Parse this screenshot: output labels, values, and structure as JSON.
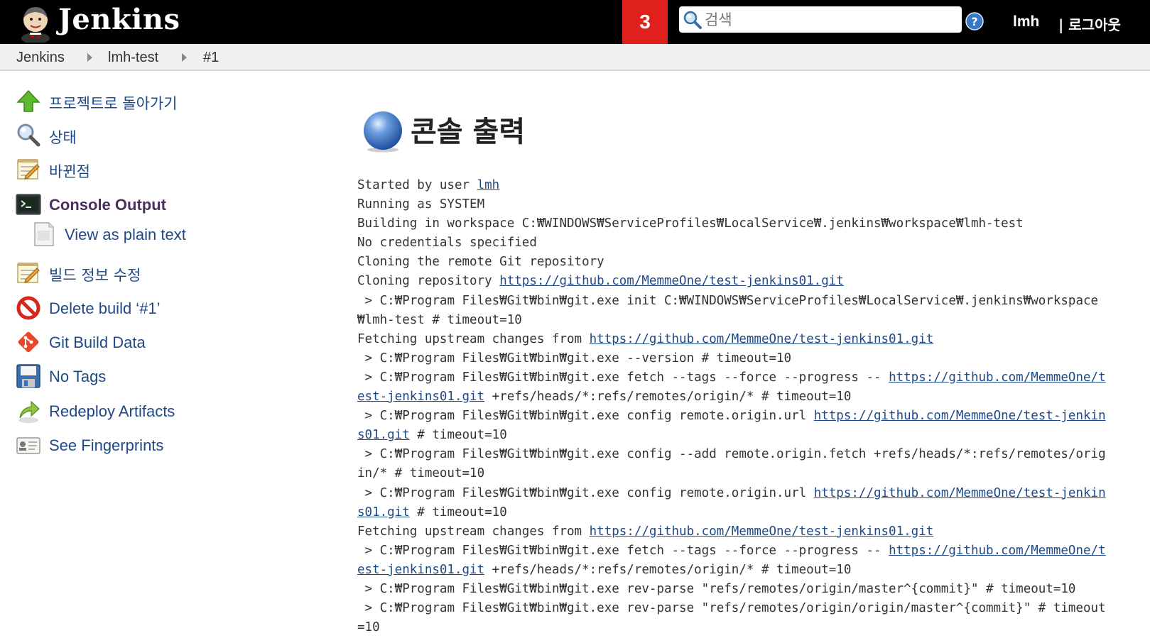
{
  "header": {
    "brand": "Jenkins",
    "notification_count": "3",
    "search_placeholder": "검색",
    "user": "lmh",
    "logout": "| 로그아웃"
  },
  "breadcrumb": [
    "Jenkins",
    "lmh-test",
    "#1"
  ],
  "side_panel": [
    {
      "label": "프로젝트로 돌아가기",
      "icon": "up-arrow-icon"
    },
    {
      "label": "상태",
      "icon": "magnifier-icon"
    },
    {
      "label": "바뀐점",
      "icon": "notepad-icon"
    },
    {
      "label": "Console Output",
      "icon": "terminal-icon",
      "active": true
    },
    {
      "label": "View as plain text",
      "icon": "document-icon"
    },
    {
      "label": "빌드 정보 수정",
      "icon": "notepad-icon"
    },
    {
      "label": "Delete build ‘#1’",
      "icon": "no-entry-icon"
    },
    {
      "label": "Git Build Data",
      "icon": "git-icon"
    },
    {
      "label": "No Tags",
      "icon": "floppy-disk-icon"
    },
    {
      "label": "Redeploy Artifacts",
      "icon": "redeploy-arrow-icon"
    },
    {
      "label": "See Fingerprints",
      "icon": "fingerprint-card-icon"
    }
  ],
  "main": {
    "title": "콘솔 출력",
    "console_lines": [
      [
        {
          "t": "Started by user "
        },
        {
          "t": "lmh",
          "link": true
        }
      ],
      [
        {
          "t": "Running as SYSTEM"
        }
      ],
      [
        {
          "t": "Building in workspace C:₩WINDOWS₩ServiceProfiles₩LocalService₩.jenkins₩workspace₩lmh-test"
        }
      ],
      [
        {
          "t": "No credentials specified"
        }
      ],
      [
        {
          "t": "Cloning the remote Git repository"
        }
      ],
      [
        {
          "t": "Cloning repository "
        },
        {
          "t": "https://github.com/MemmeOne/test-jenkins01.git",
          "link": true
        }
      ],
      [
        {
          "t": " > C:₩Program Files₩Git₩bin₩git.exe init C:₩WINDOWS₩ServiceProfiles₩LocalService₩.jenkins₩workspace₩lmh-test # timeout=10"
        }
      ],
      [
        {
          "t": "Fetching upstream changes from "
        },
        {
          "t": "https://github.com/MemmeOne/test-jenkins01.git",
          "link": true
        }
      ],
      [
        {
          "t": " > C:₩Program Files₩Git₩bin₩git.exe --version # timeout=10"
        }
      ],
      [
        {
          "t": " > C:₩Program Files₩Git₩bin₩git.exe fetch --tags --force --progress -- "
        },
        {
          "t": "https://github.com/MemmeOne/test-jenkins01.git",
          "link": true
        },
        {
          "t": " +refs/heads/*:refs/remotes/origin/* # timeout=10"
        }
      ],
      [
        {
          "t": " > C:₩Program Files₩Git₩bin₩git.exe config remote.origin.url "
        },
        {
          "t": "https://github.com/MemmeOne/test-jenkins01.git",
          "link": true
        },
        {
          "t": " # timeout=10"
        }
      ],
      [
        {
          "t": " > C:₩Program Files₩Git₩bin₩git.exe config --add remote.origin.fetch +refs/heads/*:refs/remotes/origin/* # timeout=10"
        }
      ],
      [
        {
          "t": " > C:₩Program Files₩Git₩bin₩git.exe config remote.origin.url "
        },
        {
          "t": "https://github.com/MemmeOne/test-jenkins01.git",
          "link": true
        },
        {
          "t": " # timeout=10"
        }
      ],
      [
        {
          "t": "Fetching upstream changes from "
        },
        {
          "t": "https://github.com/MemmeOne/test-jenkins01.git",
          "link": true
        }
      ],
      [
        {
          "t": " > C:₩Program Files₩Git₩bin₩git.exe fetch --tags --force --progress -- "
        },
        {
          "t": "https://github.com/MemmeOne/test-jenkins01.git",
          "link": true
        },
        {
          "t": " +refs/heads/*:refs/remotes/origin/* # timeout=10"
        }
      ],
      [
        {
          "t": " > C:₩Program Files₩Git₩bin₩git.exe rev-parse \"refs/remotes/origin/master^{commit}\" # timeout=10"
        }
      ],
      [
        {
          "t": " > C:₩Program Files₩Git₩bin₩git.exe rev-parse \"refs/remotes/origin/origin/master^{commit}\" # timeout=10"
        }
      ]
    ]
  },
  "colors": {
    "header_bg": "#000000",
    "notification_bg": "#e0201d",
    "breadcrumb_bg": "#f0f0f0",
    "link": "#204a87",
    "active_task": "#4a2f5f"
  }
}
